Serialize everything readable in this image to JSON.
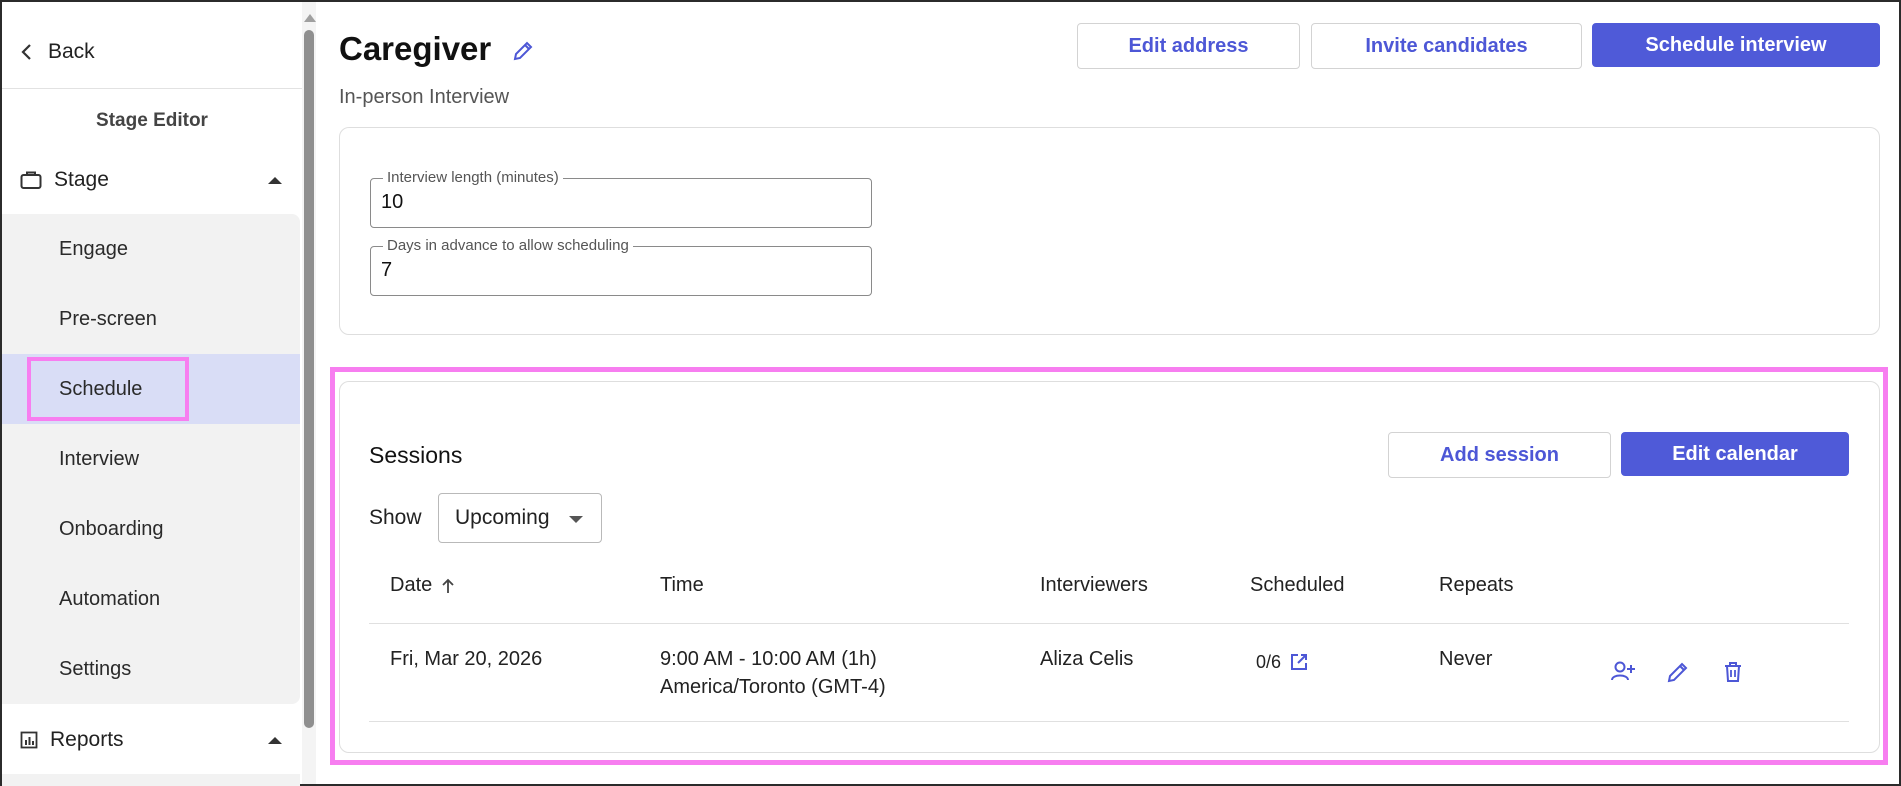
{
  "sidebar": {
    "back_label": "Back",
    "editor_title": "Stage Editor",
    "stage_section": "Stage",
    "items": [
      {
        "label": "Engage"
      },
      {
        "label": "Pre-screen"
      },
      {
        "label": "Schedule"
      },
      {
        "label": "Interview"
      },
      {
        "label": "Onboarding"
      },
      {
        "label": "Automation"
      },
      {
        "label": "Settings"
      }
    ],
    "active_item": "Schedule",
    "reports_section": "Reports"
  },
  "header": {
    "title": "Caregiver",
    "subtitle": "In-person Interview",
    "buttons": {
      "edit_address": "Edit address",
      "invite_candidates": "Invite candidates",
      "schedule_interview": "Schedule interview"
    }
  },
  "settings_card": {
    "interview_length_label": "Interview length (minutes)",
    "interview_length_value": "10",
    "days_advance_label": "Days in advance to allow scheduling",
    "days_advance_value": "7"
  },
  "sessions": {
    "title": "Sessions",
    "add_session": "Add session",
    "edit_calendar": "Edit calendar",
    "show_label": "Show",
    "show_selected": "Upcoming",
    "columns": {
      "date": "Date",
      "time": "Time",
      "interviewers": "Interviewers",
      "scheduled": "Scheduled",
      "repeats": "Repeats"
    },
    "rows": [
      {
        "date": "Fri, Mar 20, 2026",
        "time_line1": "9:00 AM - 10:00 AM (1h)",
        "time_line2": "America/Toronto (GMT-4)",
        "interviewers": "Aliza Celis",
        "scheduled": "0/6",
        "repeats": "Never"
      }
    ]
  },
  "colors": {
    "accent": "#4f5ad8",
    "active_nav": "#d9ddf6",
    "highlight": "#f77ef0"
  }
}
